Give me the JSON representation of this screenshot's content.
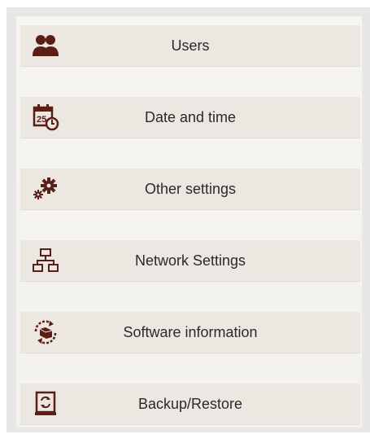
{
  "menu": {
    "items": [
      {
        "label": "Users",
        "icon": "users-icon"
      },
      {
        "label": "Date and time",
        "icon": "calendar-clock-icon"
      },
      {
        "label": "Other settings",
        "icon": "gears-icon"
      },
      {
        "label": "Network Settings",
        "icon": "network-icon"
      },
      {
        "label": "Software information",
        "icon": "software-update-icon"
      },
      {
        "label": "Backup/Restore",
        "icon": "backup-drive-icon"
      }
    ]
  },
  "colors": {
    "icon": "#5a1e16",
    "item_bg": "#ece7e1",
    "panel_bg": "#e7e7e7"
  }
}
